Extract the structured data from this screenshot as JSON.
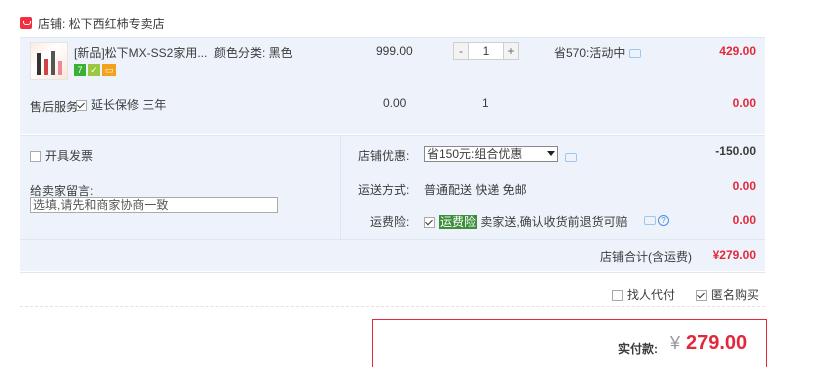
{
  "shop": {
    "name": "店铺: 松下西红柿专卖店"
  },
  "item": {
    "title": "[新品]松下MX-SS2家用...",
    "sku": "颜色分类: 黑色",
    "price": "999.00",
    "minus_label": "-",
    "quantity": "1",
    "plus_label": "+",
    "promo": "省570:活动中",
    "subtotal": "429.00"
  },
  "service": {
    "label": "售后服务",
    "option": "延长保修 三年",
    "price": "0.00",
    "quantity": "1",
    "subtotal": "0.00"
  },
  "invoice": {
    "label": "开具发票"
  },
  "discount": {
    "label": "店铺优惠:",
    "selected": "省150元:组合优惠",
    "amount": "-150.00"
  },
  "message": {
    "label": "给卖家留言:",
    "placeholder": "选填,请先和商家协商一致"
  },
  "shipping": {
    "label": "运送方式:",
    "method": "普通配送 快递 免邮",
    "amount": "0.00"
  },
  "insurance": {
    "label": "运费险:",
    "tag": "运费险",
    "text": " 卖家送,确认收货前退货可赔",
    "amount": "0.00"
  },
  "total": {
    "label": "店铺合计(含运费)",
    "amount": "¥279.00"
  },
  "options": {
    "proxy_label": "找人代付",
    "anon_label": "匿名购买"
  },
  "payment": {
    "label": "实付款:",
    "currency": "¥",
    "amount": "279.00"
  },
  "colors": {
    "accent": "#e4283c",
    "panel": "#eef3fb"
  }
}
